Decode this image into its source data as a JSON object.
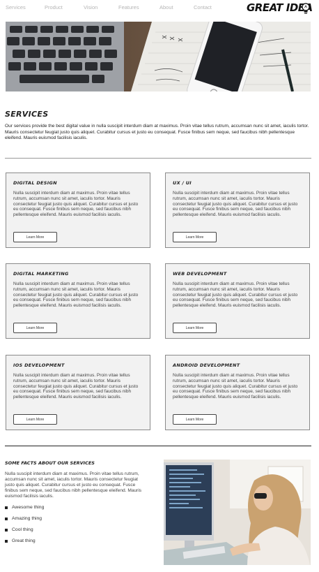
{
  "nav": {
    "items": [
      "Services",
      "Product",
      "Vision",
      "Features",
      "About",
      "Contact"
    ],
    "logo": "GREAT IDEA"
  },
  "services": {
    "heading": "SERVICES",
    "intro": "Our services provide the best digital value in nulla suscipit interdum diam at maximus. Proin vitae tellus rutrum, accumsan nunc sit amet, iaculis tortor. Mauris consectetur feugiat justo quis aliquet. Curabitur cursus et justo eu consequat. Fusce finibus sem neque, sed faucibus nibh pellentesque eleifend. Mauris euismod facilisis iaculis.",
    "cards": [
      {
        "title": "Digital Design",
        "text": "Nulla suscipit interdum diam at maximus. Proin vitae tellus rutrum, accumsan nunc sit amet, iaculis tortor. Mauris consectetur feugiat justo quis aliquet. Curabitur cursus et justo eu consequat. Fusce finibus sem neque, sed faucibus nibh pellentesque eleifend. Mauris euismod facilisis iaculis.",
        "button": "Learn More"
      },
      {
        "title": "UX / UI",
        "text": "Nulla suscipit interdum diam at maximus. Proin vitae tellus rutrum, accumsan nunc sit amet, iaculis tortor. Mauris consectetur feugiat justo quis aliquet. Curabitur cursus et justo eu consequat. Fusce finibus sem neque, sed faucibus nibh pellentesque eleifend. Mauris euismod facilisis iaculis.",
        "button": "Learn More"
      },
      {
        "title": "Digital Marketing",
        "text": "Nulla suscipit interdum diam at maximus. Proin vitae tellus rutrum, accumsan nunc sit amet, iaculis tortor. Mauris consectetur feugiat justo quis aliquet. Curabitur cursus et justo eu consequat. Fusce finibus sem neque, sed faucibus nibh pellentesque eleifend. Mauris euismod facilisis iaculis.",
        "button": "Learn More"
      },
      {
        "title": "Web Development",
        "text": "Nulla suscipit interdum diam at maximus. Proin vitae tellus rutrum, accumsan nunc sit amet, iaculis tortor. Mauris consectetur feugiat justo quis aliquet. Curabitur cursus et justo eu consequat. Fusce finibus sem neque, sed faucibus nibh pellentesque eleifend. Mauris euismod facilisis iaculis.",
        "button": "Learn More"
      },
      {
        "title": "iOS Development",
        "text": "Nulla suscipit interdum diam at maximus. Proin vitae tellus rutrum, accumsan nunc sit amet, iaculis tortor. Mauris consectetur feugiat justo quis aliquet. Curabitur cursus et justo eu consequat. Fusce finibus sem neque, sed faucibus nibh pellentesque eleifend. Mauris euismod facilisis iaculis.",
        "button": "Learn More"
      },
      {
        "title": "Android Development",
        "text": "Nulla suscipit interdum diam at maximus. Proin vitae tellus rutrum, accumsan nunc sit amet, iaculis tortor. Mauris consectetur feugiat justo quis aliquet. Curabitur cursus et justo eu consequat. Fusce finibus sem neque, sed faucibus nibh pellentesque eleifend. Mauris euismod facilisis iaculis.",
        "button": "Learn More"
      }
    ]
  },
  "facts": {
    "heading": "SOME FACTS ABOUT OUR SERVICES",
    "text": "Nulla suscipit interdum diam at maximus. Proin vitae tellus rutrum, accumsan nunc sit amet, iaculis tortor. Mauris consectetur feugiat justo quis aliquet. Curabitur cursus et justo eu consequat. Fusce finibus sem neque, sed faucibus nibh pellentesque eleifend. Mauris euismod facilisis iaculis.",
    "list": [
      "Awesome thing",
      "Amazing thing",
      "Cool thing",
      "Great thing"
    ]
  }
}
